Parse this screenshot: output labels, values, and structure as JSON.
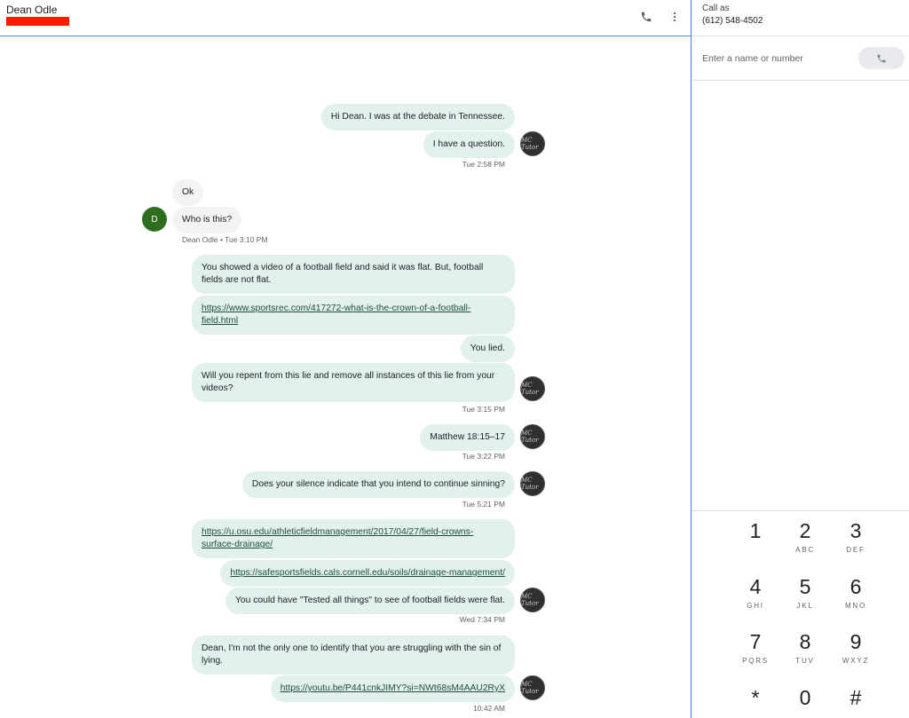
{
  "header": {
    "contact_name": "Dean Odle"
  },
  "right_panel": {
    "call_as_label": "Call as",
    "call_as_number": "(612) 548-4502",
    "input_placeholder": "Enter a name or number",
    "dialpad": [
      {
        "digit": "1",
        "letters": ""
      },
      {
        "digit": "2",
        "letters": "ABC"
      },
      {
        "digit": "3",
        "letters": "DEF"
      },
      {
        "digit": "4",
        "letters": "GHI"
      },
      {
        "digit": "5",
        "letters": "JKL"
      },
      {
        "digit": "6",
        "letters": "MNO"
      },
      {
        "digit": "7",
        "letters": "PQRS"
      },
      {
        "digit": "8",
        "letters": "TUV"
      },
      {
        "digit": "9",
        "letters": "WXYZ"
      },
      {
        "digit": "*",
        "letters": ""
      },
      {
        "digit": "0",
        "letters": ""
      },
      {
        "digit": "#",
        "letters": ""
      }
    ]
  },
  "avatars": {
    "self_text": "MC Tutor",
    "contact_initial": "D"
  },
  "messages": [
    {
      "text": "Hi Dean.  I was at the debate in Tennessee."
    },
    {
      "text": "I have a question."
    },
    {
      "time": "Tue 2:58 PM"
    },
    {
      "text": "Ok"
    },
    {
      "text": "Who is this?"
    },
    {
      "time": "Dean Odle • Tue 3:10 PM"
    },
    {
      "text": "You showed a video of a football field and said it was flat.  But, football fields are not flat."
    },
    {
      "text": "https://www.sportsrec.com/417272-what-is-the-crown-of-a-football-field.html"
    },
    {
      "text": "You lied."
    },
    {
      "text": "Will you repent from this lie and remove all instances of this lie from your videos?"
    },
    {
      "time": "Tue 3:15 PM"
    },
    {
      "text": "Matthew 18:15–17"
    },
    {
      "time": "Tue 3:22 PM"
    },
    {
      "text": "Does your silence indicate that you intend to continue sinning?"
    },
    {
      "time": "Tue 5:21 PM"
    },
    {
      "text": "https://u.osu.edu/athleticfieldmanagement/2017/04/27/field-crowns-surface-drainage/"
    },
    {
      "text": "https://safesportsfields.cals.cornell.edu/soils/drainage-management/"
    },
    {
      "text": "You could have \"Tested all things\" to see of football fields were flat."
    },
    {
      "time": "Wed 7:34 PM"
    },
    {
      "text": "Dean, I'm not the only one to identify that you are struggling with the sin of lying."
    },
    {
      "text": "https://youtu.be/P441cnkJIMY?si=NWt68sM4AAU2RyX"
    },
    {
      "time": "10:42 AM"
    }
  ]
}
